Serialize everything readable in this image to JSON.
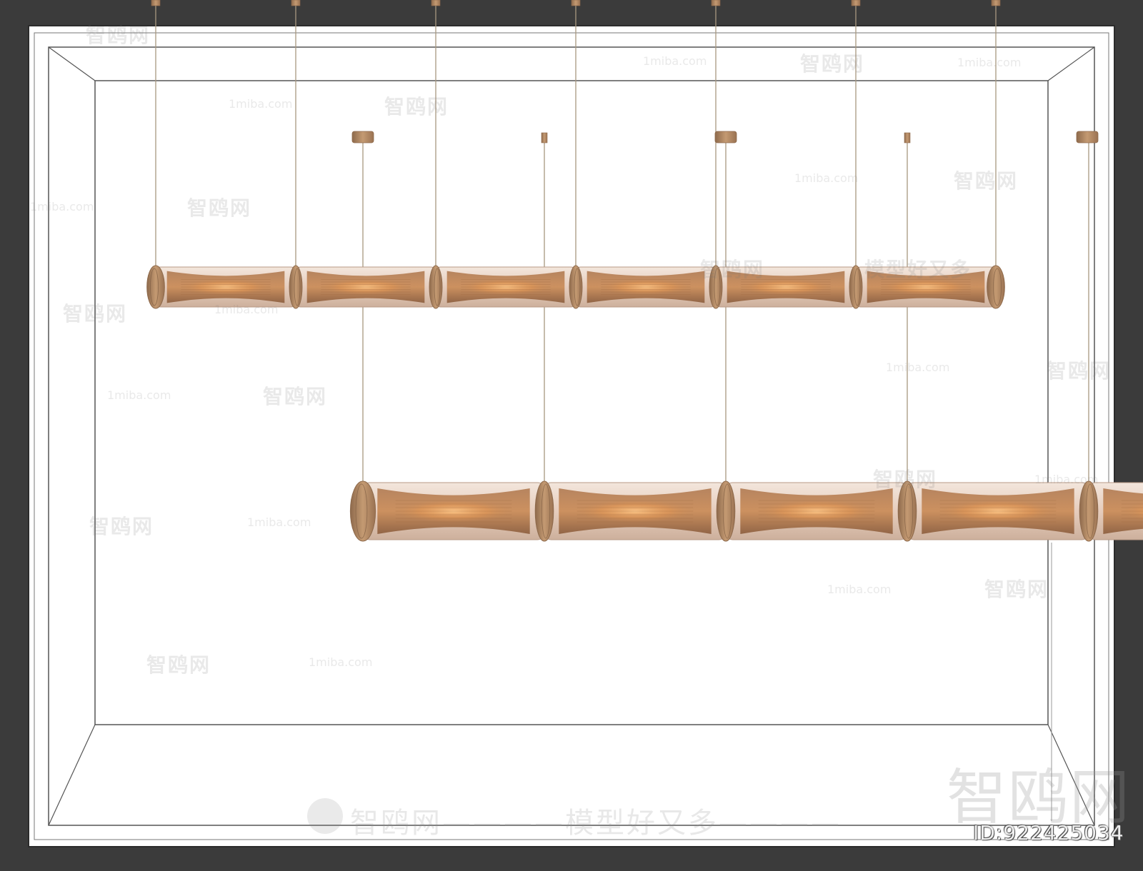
{
  "scene": {
    "title": "Bamboo linear pendant lamps 3D render",
    "colors": {
      "background": "#3b3b3b",
      "canvas": "#ffffff",
      "frame_line": "#555555",
      "wire": "#a89880",
      "metal": "#c49a72",
      "metal_dark": "#8e6a4c",
      "glass": "#ead6c8",
      "glow": "#e89a55"
    },
    "lamps": [
      {
        "name": "upper-lamp",
        "segments": 6,
        "suspension_wires": 7
      },
      {
        "name": "lower-lamp",
        "segments": 5,
        "suspension_wires": 5
      }
    ]
  },
  "watermarks": {
    "site": "1miba.com",
    "brand_cn": "智鸥网",
    "slogan_cn": "模型好又多",
    "big": "智鸥网",
    "bottom": "智鸥网————模型好又多————",
    "id_label": "ID:922425034"
  }
}
